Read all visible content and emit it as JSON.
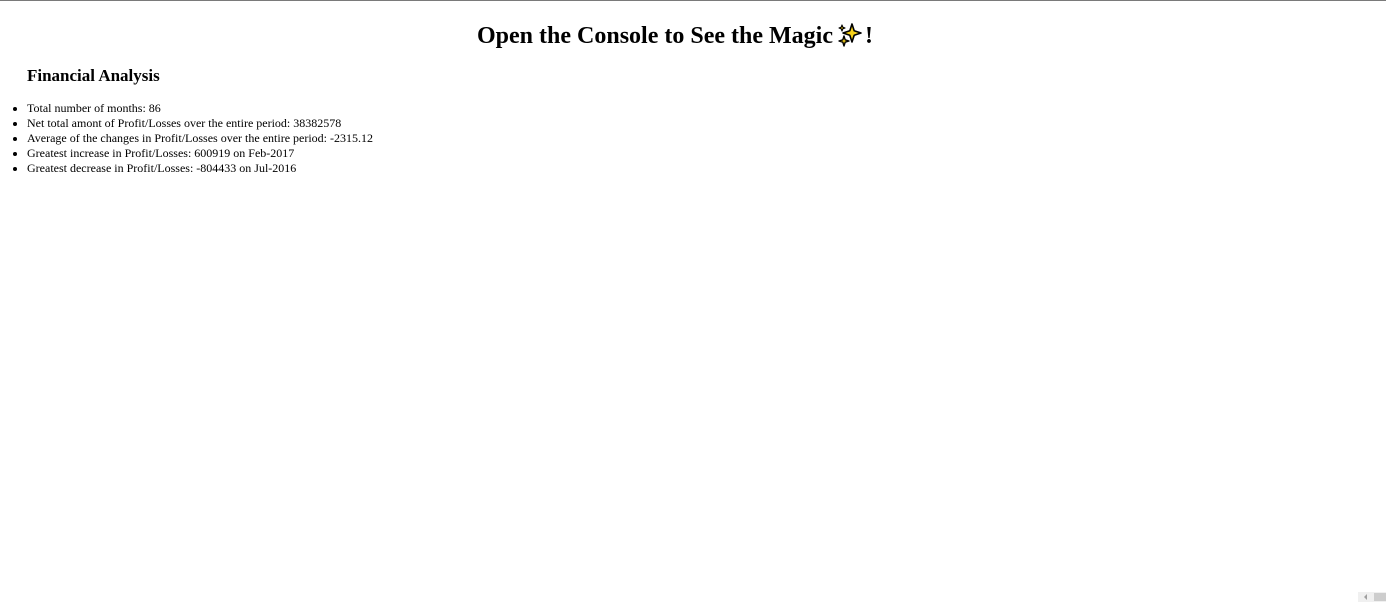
{
  "header": {
    "title_text": "Open the Console to See the Magic",
    "title_suffix": "!",
    "title_icon": "sparkles-icon"
  },
  "analysis": {
    "heading": "Financial Analysis",
    "items": [
      "Total number of months: 86",
      "Net total amont of Profit/Losses over the entire period: 38382578",
      "Average of the changes in Profit/Losses over the entire period: -2315.12",
      "Greatest increase in Profit/Losses: 600919 on Feb-2017",
      "Greatest decrease in Profit/Losses: -804433 on Jul-2016"
    ]
  },
  "colors": {
    "sparkle_fill": "#f8d21a",
    "sparkle_stroke": "#000000"
  }
}
